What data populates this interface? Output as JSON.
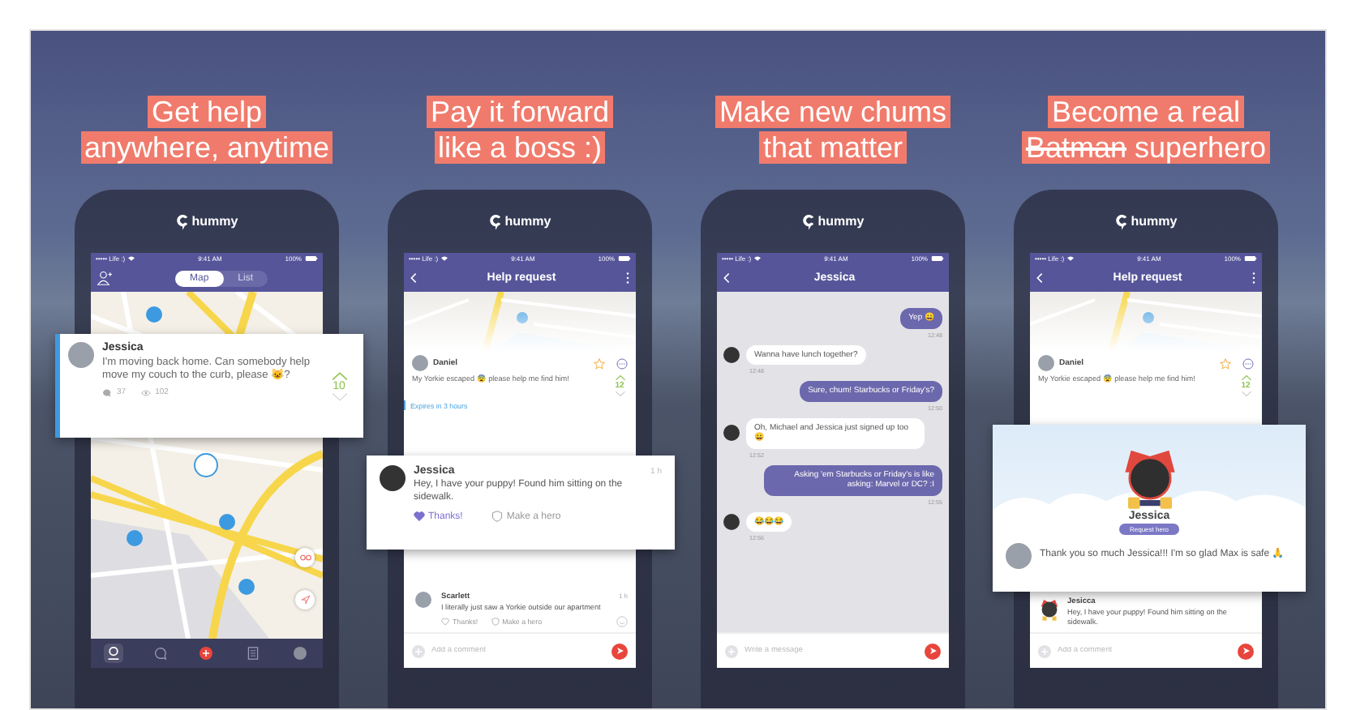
{
  "panels": [
    {
      "headline": [
        [
          {
            "text": "Get help",
            "struck": false
          }
        ],
        [
          {
            "text": "anywhere, anytime",
            "struck": false
          }
        ]
      ],
      "brand": "hummy",
      "status": {
        "carrier": "••••• Life :)",
        "time": "9:41 AM",
        "battery": "100%"
      },
      "header": {
        "kind": "tabs",
        "tabs": [
          {
            "label": "Map",
            "selected": true
          },
          {
            "label": "List",
            "selected": false
          }
        ]
      },
      "body": {
        "kind": "map",
        "nav": [
          {
            "kind": "pin",
            "selected": true
          },
          {
            "kind": "chat",
            "selected": false
          },
          {
            "kind": "add",
            "selected": false
          },
          {
            "kind": "list",
            "selected": false
          },
          {
            "kind": "avatar",
            "selected": false
          }
        ]
      },
      "card": {
        "kind": "post",
        "author": "Jessica",
        "text": "I'm moving back home. Can somebody help move my couch to the curb, please 😺?",
        "vote": "10",
        "comments": "37",
        "views": "102"
      }
    },
    {
      "headline": [
        [
          {
            "text": "Pay it forward",
            "struck": false
          }
        ],
        [
          {
            "text": "like a boss :)",
            "struck": false
          }
        ]
      ],
      "brand": "hummy",
      "status": {
        "carrier": "••••• Life :)",
        "time": "9:41 AM",
        "battery": "100%"
      },
      "header": {
        "kind": "title",
        "title": "Help request",
        "menu": true
      },
      "body": {
        "kind": "request",
        "post": {
          "author": "Daniel",
          "text": "My Yorkie escaped 😨 please help me find him!",
          "vote": "12"
        },
        "expires": "Expires in 3 hours",
        "comments": [
          {
            "author": "Scarlett",
            "time": "1 h",
            "text": "I literally just saw a Yorkie outside our apartment",
            "thanks": "Thanks!",
            "liked": false,
            "hero": "Make a hero",
            "hero_badge": false
          }
        ],
        "placeholder": "Add a comment"
      },
      "card": {
        "kind": "reply",
        "author": "Jessica",
        "time": "1 h",
        "text": "Hey, I have your puppy! Found him sitting on the sidewalk.",
        "thanks": "Thanks!",
        "liked": true,
        "hero": "Make a hero"
      }
    },
    {
      "headline": [
        [
          {
            "text": "Make new chums",
            "struck": false
          }
        ],
        [
          {
            "text": "that matter",
            "struck": false
          }
        ]
      ],
      "brand": "hummy",
      "status": {
        "carrier": "••••• Life :)",
        "time": "9:41 AM",
        "battery": "100%"
      },
      "header": {
        "kind": "title",
        "title": "Jessica",
        "menu": false
      },
      "body": {
        "kind": "chat",
        "messages": [
          {
            "kind": "outgoing",
            "text": "Yep 😀",
            "time": "12:48"
          },
          {
            "kind": "incoming",
            "text": "Wanna have lunch together?",
            "time": "12:48"
          },
          {
            "kind": "outgoing",
            "text": "Sure, chum! Starbucks or Friday's?",
            "time": "12:50"
          },
          {
            "kind": "incoming",
            "text": "Oh, Michael and Jessica just signed up too 😀",
            "time": "12:52"
          },
          {
            "kind": "outgoing",
            "text": "Asking 'em Starbucks or Friday's is like asking: Marvel or DC? :I",
            "time": "12:55"
          },
          {
            "kind": "incoming",
            "text": "😂😂😂",
            "time": "12:56"
          }
        ],
        "placeholder": "Write a message"
      }
    },
    {
      "headline": [
        [
          {
            "text": "Become a real",
            "struck": false
          }
        ],
        [
          {
            "text": "Batman",
            "struck": true
          },
          {
            "text": " superhero",
            "struck": false
          }
        ]
      ],
      "brand": "hummy",
      "status": {
        "carrier": "••••• Life :)",
        "time": "9:41 AM",
        "battery": "100%"
      },
      "header": {
        "kind": "title",
        "title": "Help request",
        "menu": true
      },
      "body": {
        "kind": "request",
        "post": {
          "author": "Daniel",
          "text": "My Yorkie escaped 😨 please help me find him!",
          "vote": "12"
        },
        "comments": [
          {
            "author": "Jesicca",
            "text": "Hey, I have your puppy! Found him sitting on the sidewalk.",
            "hero_badge": true
          }
        ],
        "placeholder": "Add a comment"
      },
      "card": {
        "kind": "hero",
        "author": "Jessica",
        "badge": "Request hero",
        "message": "Thank you so much Jessica!!! I'm so glad Max is safe 🙏"
      }
    }
  ]
}
